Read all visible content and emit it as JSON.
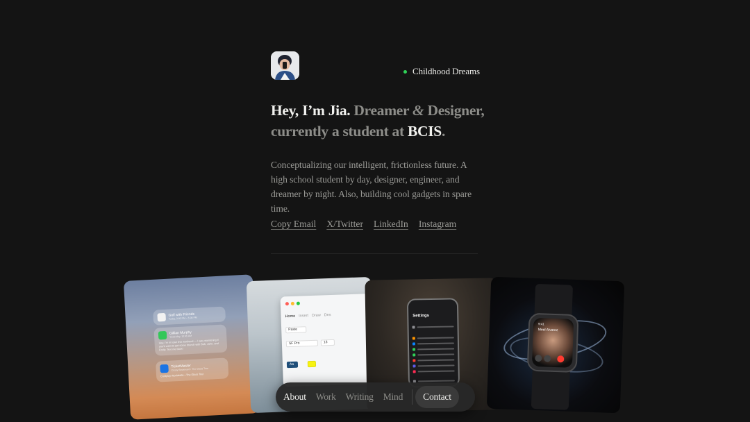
{
  "profile": {
    "status_label": "Childhood Dreams",
    "status_color": "#2fd157",
    "headline": {
      "greeting": "Hey, I’m Jia.",
      "role_a": "Dreamer",
      "amp": "&",
      "role_b": "Designer,",
      "line2_prefix": "currently a student at",
      "school": "BCIS",
      "period": "."
    },
    "bio": "Conceptualizing our intelligent, frictionless future. A high school student by day, designer, engineer, and dreamer by night. Also, building cool gadgets in spare time.",
    "links": [
      "Copy Email",
      "X/Twitter",
      "LinkedIn",
      "Instagram"
    ]
  },
  "gallery": {
    "notifications": [
      {
        "title": "Golf with Friends",
        "sub": "Today, 3:00 PM – 5:00 PM",
        "body": "",
        "icon_color": "#f2f2f2"
      },
      {
        "title": "Gillian Murphy",
        "sub": "Yesterday, 10:45 AM",
        "body": "Hey, I'm in town this weekend — I was wondering if you'd want to get some brunch with Bob, John, and Emily. Text me back!",
        "icon_color": "#34c759"
      },
      {
        "title": "TicketMaster",
        "sub": "Crissy Boulevard • The Glass Tour",
        "body": "Coldplay Worldwide • The Glass Tour",
        "icon_color": "#1b74e4"
      }
    ],
    "editor": {
      "tabs": [
        "Home",
        "Insert",
        "Draw",
        "Des"
      ],
      "font": "SF Pro",
      "size": "13",
      "paste_label": "Paste",
      "style_label": "Aa"
    },
    "phone": {
      "title": "Settings"
    },
    "watch": {
      "caller": "Meel Alvarez",
      "time": "9:41"
    }
  },
  "nav": {
    "items": [
      "About",
      "Work",
      "Writing",
      "Mind"
    ],
    "active": "About",
    "contact": "Contact"
  }
}
